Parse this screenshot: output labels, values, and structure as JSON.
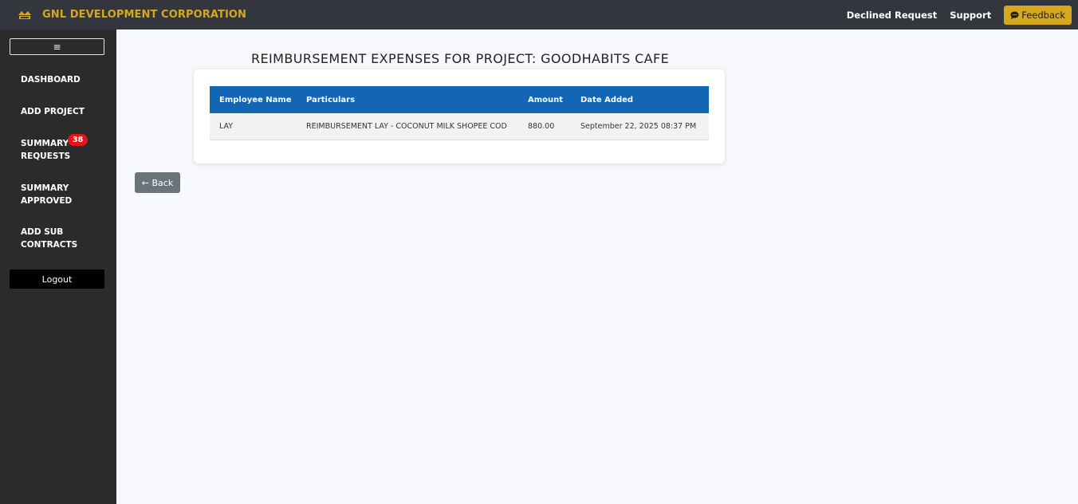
{
  "header": {
    "brand_title": "GNL DEVELOPMENT CORPORATION",
    "declined_request": "Declined Request",
    "support": "Support",
    "feedback": "Feedback",
    "brand_color": "#d6a81e",
    "bar_color": "#33373d"
  },
  "sidebar": {
    "toggle_glyph": "≡",
    "items": [
      {
        "label_line1": "DASHBOARD",
        "label_line2": ""
      },
      {
        "label_line1": "ADD PROJECT",
        "label_line2": ""
      },
      {
        "label_line1": "SUMMARY",
        "label_line2": "REQUESTS",
        "badge": "38"
      },
      {
        "label_line1": "SUMMARY",
        "label_line2": "APPROVED"
      },
      {
        "label_line1": "ADD SUB",
        "label_line2": "CONTRACTS"
      }
    ],
    "logout": "Logout"
  },
  "main": {
    "title": "REIMBURSEMENT EXPENSES FOR PROJECT: GOODHABITS CAFE",
    "table": {
      "headers": [
        "Employee Name",
        "Particulars",
        "Amount",
        "Date Added"
      ],
      "rows": [
        [
          "LAY",
          "REIMBURSEMENT LAY - COCONUT MILK SHOPEE COD",
          "880.00",
          "September 22, 2025 08:37 PM"
        ]
      ],
      "header_color": "#1266b4"
    },
    "back_button": "← Back"
  }
}
